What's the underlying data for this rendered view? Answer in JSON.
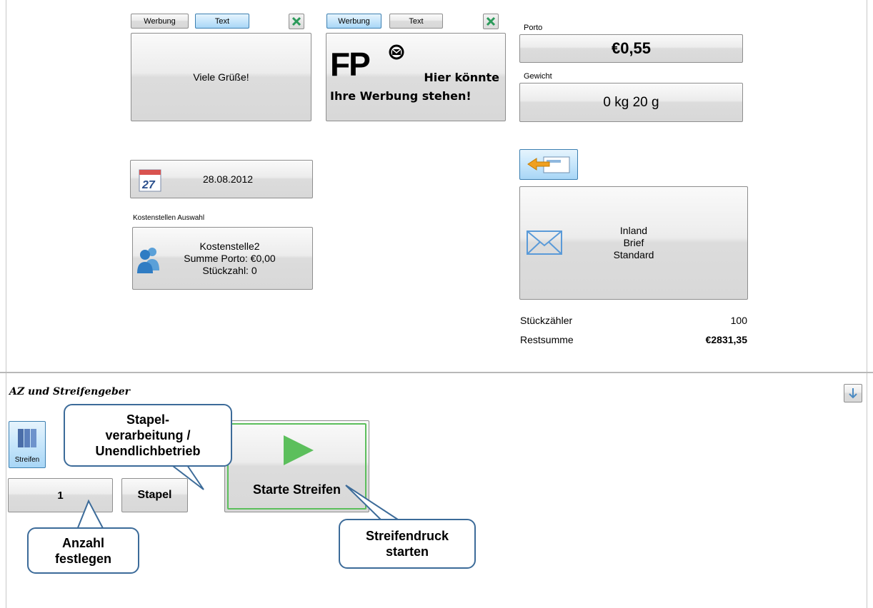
{
  "left_ad": {
    "werbung_label": "Werbung",
    "text_label": "Text",
    "message": "Viele Grüße!"
  },
  "right_ad": {
    "werbung_label": "Werbung",
    "text_label": "Text",
    "logo_text": "FP",
    "ad_line1": "Hier könnte",
    "ad_line2": "Ihre Werbung stehen!"
  },
  "porto": {
    "label": "Porto",
    "value": "€0,55"
  },
  "gewicht": {
    "label": "Gewicht",
    "value": "0 kg 20 g"
  },
  "date": {
    "value": "28.08.2012",
    "calendar_day": "27"
  },
  "kostenstelle": {
    "section_label": "Kostenstellen Auswahl",
    "name": "Kostenstelle2",
    "summe": "Summe Porto: €0,00",
    "stueckzahl": "Stückzahl: 0"
  },
  "product": {
    "line1": "Inland",
    "line2": "Brief",
    "line3": "Standard"
  },
  "stats": {
    "stueckzaehler_label": "Stückzähler",
    "stueckzaehler_value": "100",
    "restsumme_label": "Restsumme",
    "restsumme_value": "€2831,35"
  },
  "bottom": {
    "section_title": "AZ und Streifengeber",
    "streifen_label": "Streifen",
    "anzahl_value": "1",
    "stapel_label": "Stapel",
    "start_label": "Starte Streifen"
  },
  "callouts": {
    "stapel_line1": "Stapel-",
    "stapel_line2": "verarbeitung /",
    "stapel_line3": "Unendlichbetrieb",
    "anzahl_line1": "Anzahl",
    "anzahl_line2": "festlegen",
    "start_line1": "Streifendruck",
    "start_line2": "starten"
  },
  "colors": {
    "accent_blue": "#3c7fb1",
    "play_green": "#5cbf5c",
    "callout_border": "#3c6b99"
  }
}
